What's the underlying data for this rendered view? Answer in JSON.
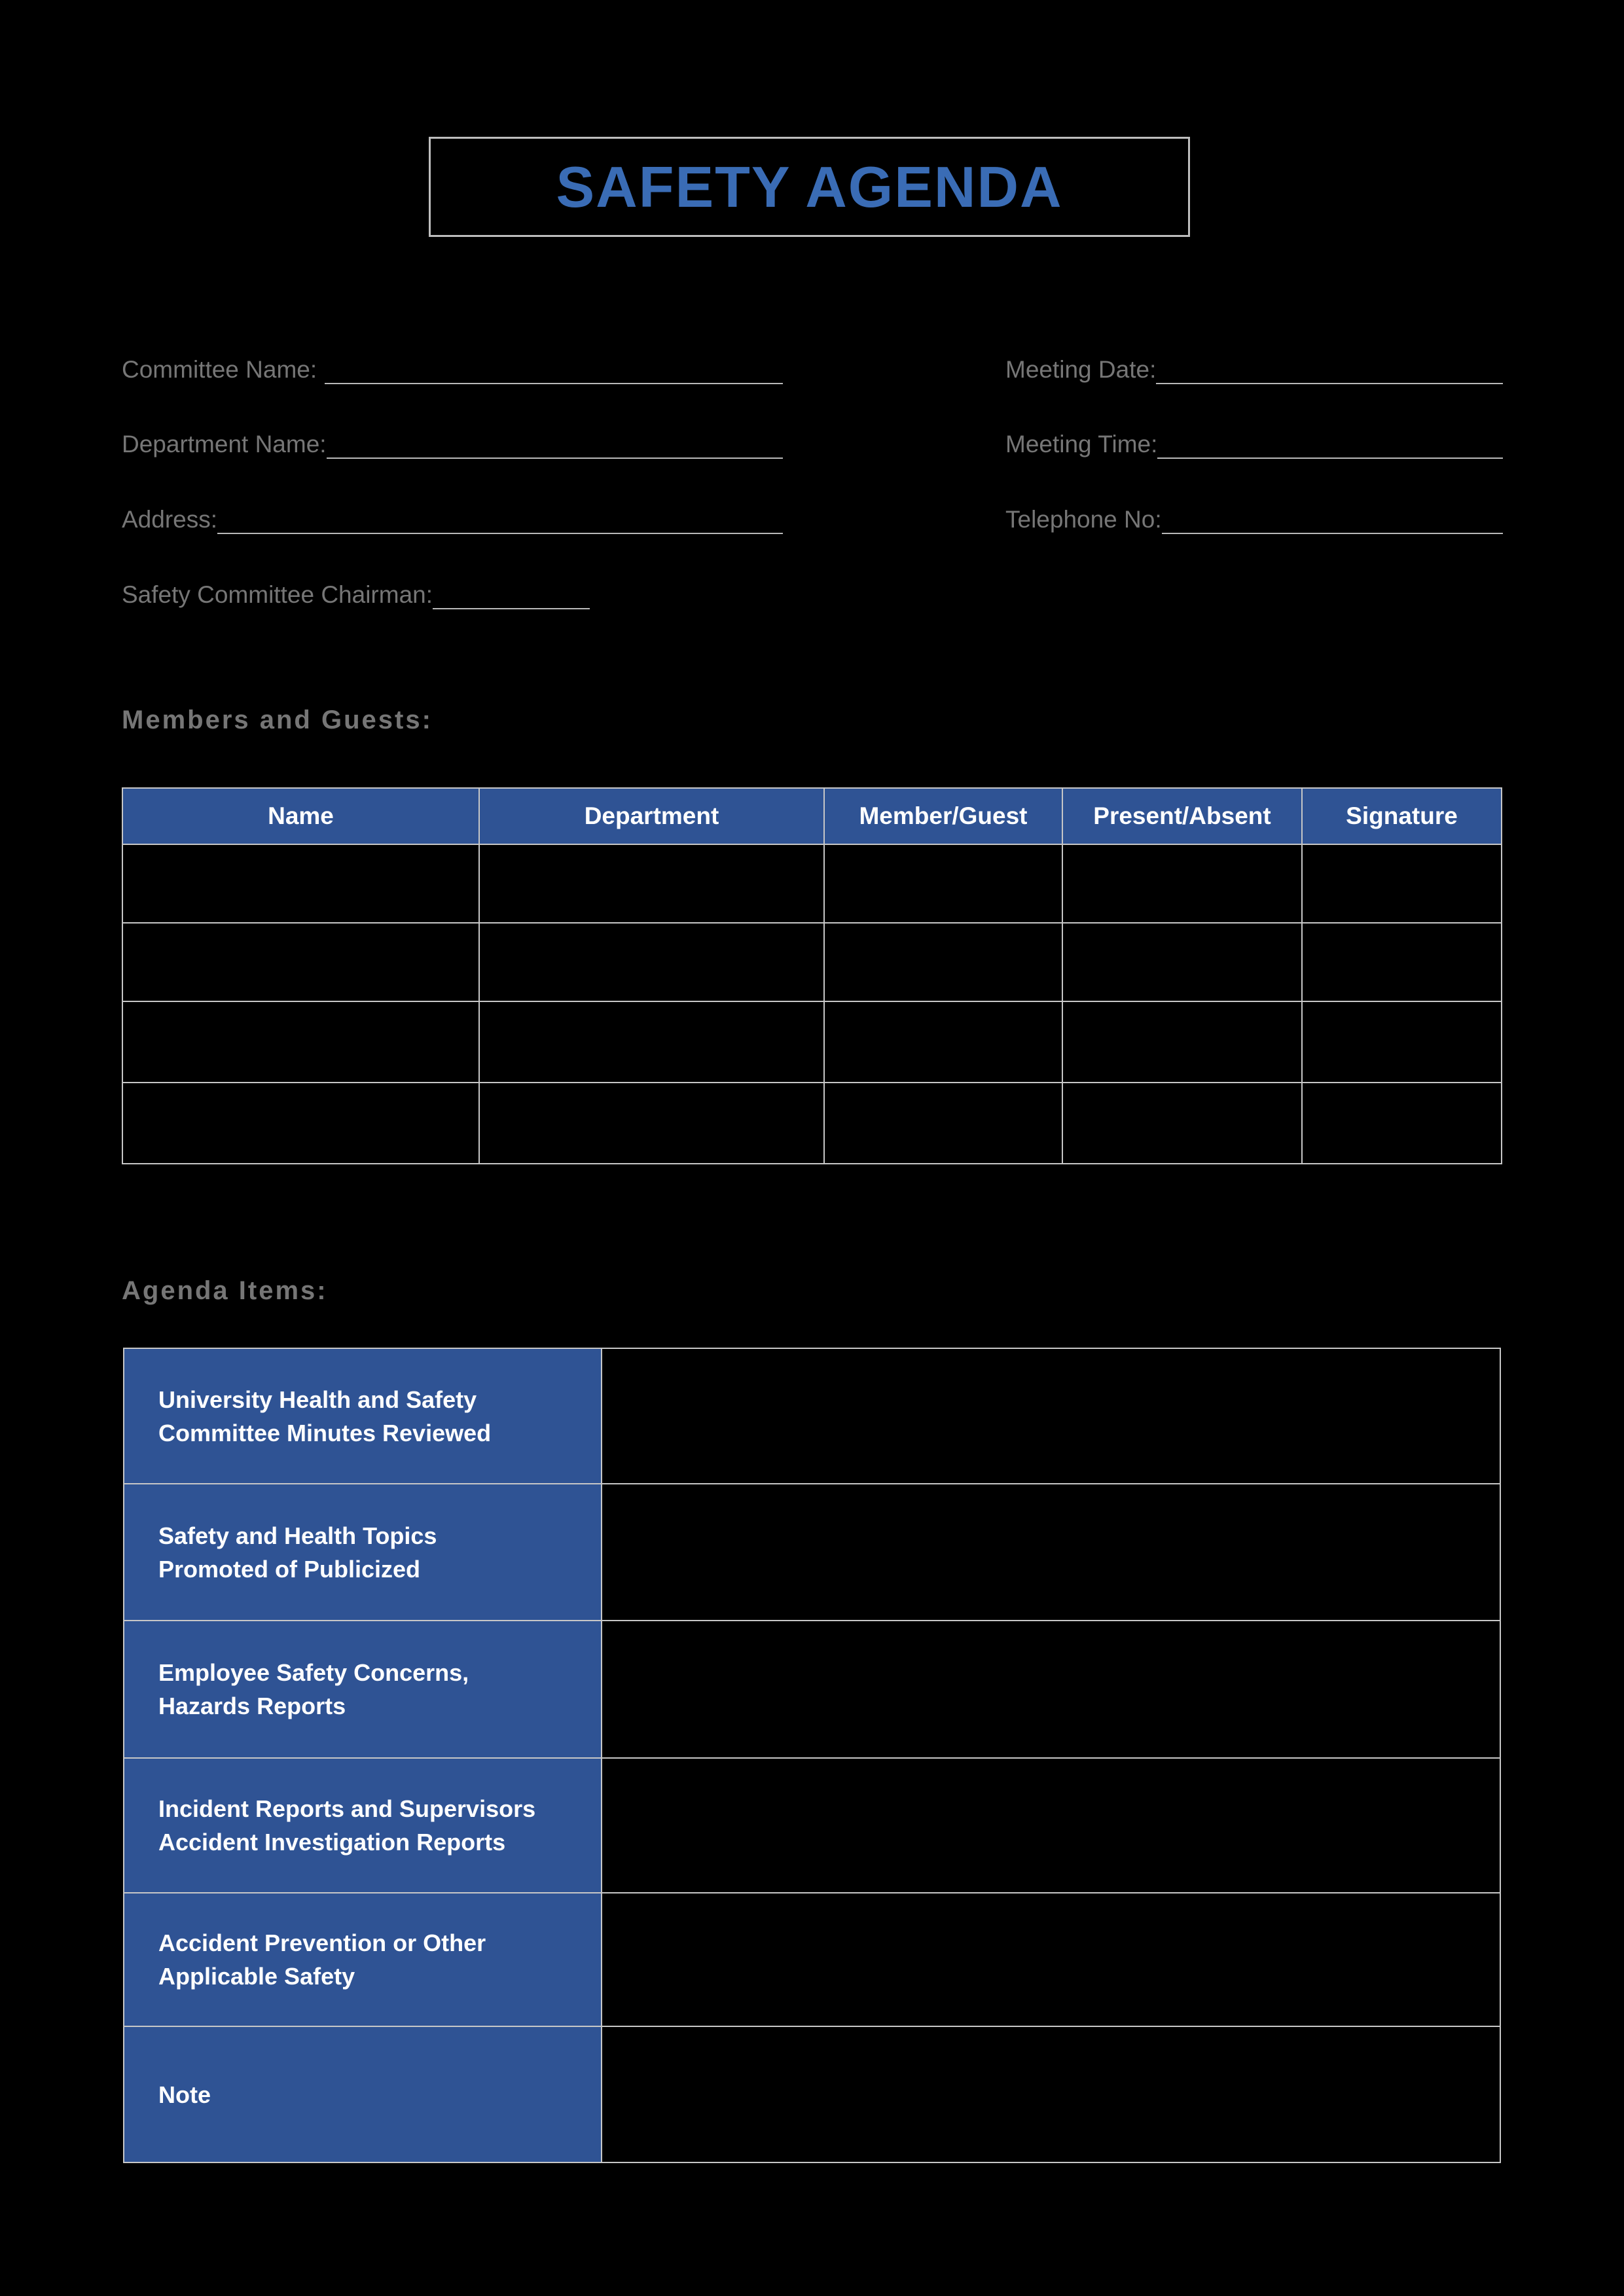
{
  "document": {
    "title": "SAFETY AGENDA"
  },
  "colors": {
    "accent_blue": "#2f5394",
    "title_blue": "#3a6cb5",
    "label_gray": "#767676",
    "border_gray": "#c7c7c7",
    "background": "#000000"
  },
  "form": {
    "left_fields": [
      {
        "label": "Committee Name:"
      },
      {
        "label": "Department Name:"
      },
      {
        "label": "Address:"
      },
      {
        "label": "Safety Committee Chairman:"
      }
    ],
    "right_fields": [
      {
        "label": "Meeting Date:"
      },
      {
        "label": "Meeting Time:"
      },
      {
        "label": "Telephone No:"
      }
    ],
    "values": {
      "committee_name": "",
      "department_name": "",
      "address": "",
      "safety_committee_chairman": "",
      "meeting_date": "",
      "meeting_time": "",
      "telephone_no": ""
    }
  },
  "members_section": {
    "heading": "Members and Guests:",
    "columns": [
      "Name",
      "Department",
      "Member/Guest",
      "Present/Absent",
      "Signature"
    ],
    "rows": [
      {
        "name": "",
        "department": "",
        "member_guest": "",
        "present_absent": "",
        "signature": ""
      },
      {
        "name": "",
        "department": "",
        "member_guest": "",
        "present_absent": "",
        "signature": ""
      },
      {
        "name": "",
        "department": "",
        "member_guest": "",
        "present_absent": "",
        "signature": ""
      },
      {
        "name": "",
        "department": "",
        "member_guest": "",
        "present_absent": "",
        "signature": ""
      }
    ]
  },
  "agenda_section": {
    "heading": "Agenda Items:",
    "items": [
      {
        "label": "University Health and Safety\nCommittee Minutes Reviewed",
        "value": ""
      },
      {
        "label": "Safety and Health Topics\nPromoted of Publicized",
        "value": ""
      },
      {
        "label": "Employee Safety Concerns,\nHazards Reports",
        "value": ""
      },
      {
        "label": "Incident Reports and Supervisors\nAccident Investigation Reports",
        "value": ""
      },
      {
        "label": "Accident Prevention or Other\nApplicable Safety",
        "value": ""
      },
      {
        "label": "Note",
        "value": ""
      }
    ]
  }
}
